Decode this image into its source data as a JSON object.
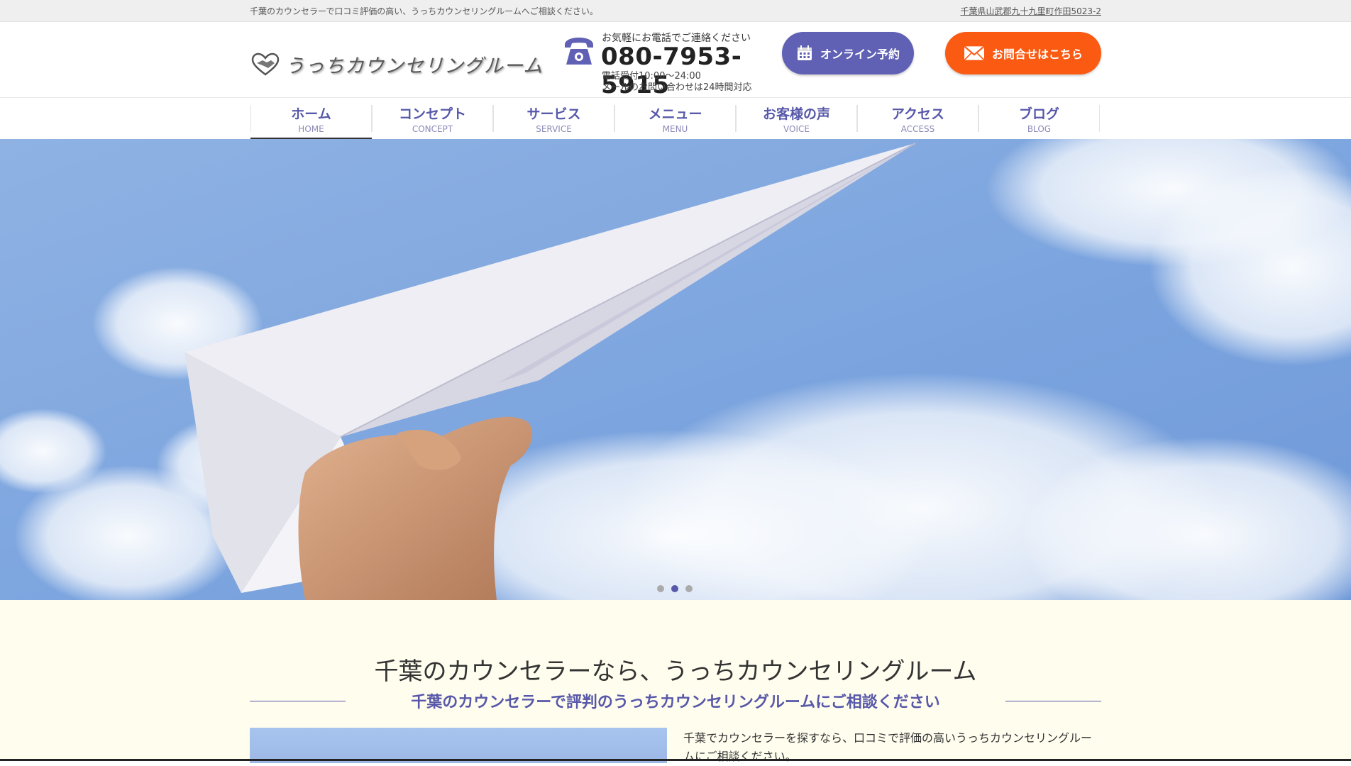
{
  "topbar": {
    "tagline": "千葉のカウンセラーで口コミ評価の高い、うっちカウンセリングルームへご相談ください。",
    "address": "千葉県山武郡九十九里町作田5023-2"
  },
  "header": {
    "logo_text": "うっちカウンセリングルーム",
    "contact": {
      "lead": "お気軽にお電話でご連絡ください",
      "phone": "080-7953-5915",
      "hours_line1": "電話受付10:00～24:00",
      "hours_line2": "メールのお問い合わせは24時間対応"
    },
    "buttons": {
      "reserve": "オンライン予約",
      "contact": "お問合せはこちら"
    }
  },
  "nav": {
    "items": [
      {
        "jp": "ホーム",
        "en": "HOME"
      },
      {
        "jp": "コンセプト",
        "en": "CONCEPT"
      },
      {
        "jp": "サービス",
        "en": "SERVICE"
      },
      {
        "jp": "メニュー",
        "en": "MENU"
      },
      {
        "jp": "お客様の声",
        "en": "VOICE"
      },
      {
        "jp": "アクセス",
        "en": "ACCESS"
      },
      {
        "jp": "ブログ",
        "en": "BLOG"
      }
    ]
  },
  "slider": {
    "slide_count": 3,
    "active_slide": 2
  },
  "section": {
    "heading": "千葉のカウンセラーなら、うっちカウンセリングルーム",
    "subheading": "千葉のカウンセラーで評判のうっちカウンセリングルームにご相談ください",
    "intro": "千葉でカウンセラーを探すなら、口コミで評価の高いうっちカウンセリングルームにご相談ください。"
  },
  "colors": {
    "brand_purple": "#5758a9",
    "reserve_button": "#6061b5",
    "contact_button": "#fb5a12",
    "section_bg": "#fffdee"
  }
}
